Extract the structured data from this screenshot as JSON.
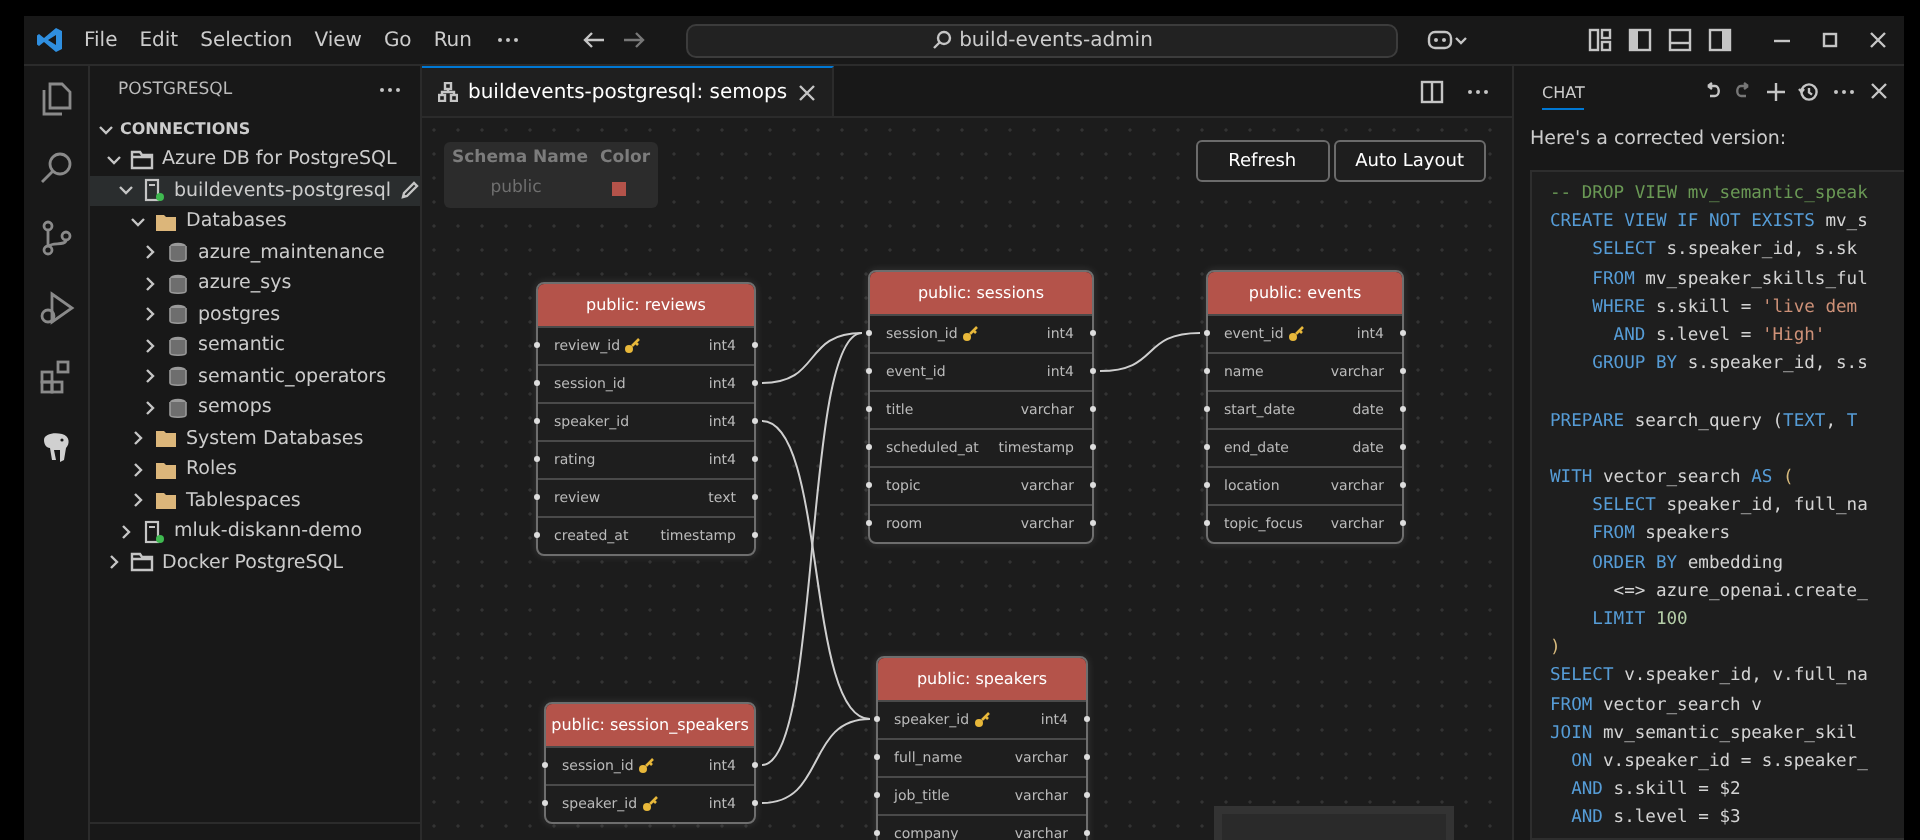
{
  "title_bar": {
    "menu": [
      "File",
      "Edit",
      "Selection",
      "View",
      "Go",
      "Run"
    ],
    "command_center": "build-events-admin"
  },
  "sidebar": {
    "title": "POSTGRESQL",
    "section": {
      "label": "CONNECTIONS",
      "expanded": true
    },
    "tree": [
      {
        "label": "Azure DB for PostgreSQL",
        "kind": "group",
        "expanded": true,
        "selected": false,
        "children": [
          {
            "label": "buildevents-postgresql",
            "kind": "server",
            "expanded": true,
            "selected": true,
            "children": [
              {
                "label": "Databases",
                "kind": "folder",
                "expanded": true,
                "selected": false,
                "children": [
                  {
                    "label": "azure_maintenance",
                    "kind": "database",
                    "expanded": false,
                    "selected": false
                  },
                  {
                    "label": "azure_sys",
                    "kind": "database",
                    "expanded": false,
                    "selected": false
                  },
                  {
                    "label": "postgres",
                    "kind": "database",
                    "expanded": false,
                    "selected": false
                  },
                  {
                    "label": "semantic",
                    "kind": "database",
                    "expanded": false,
                    "selected": false
                  },
                  {
                    "label": "semantic_operators",
                    "kind": "database",
                    "expanded": false,
                    "selected": false
                  },
                  {
                    "label": "semops",
                    "kind": "database",
                    "expanded": false,
                    "selected": false
                  }
                ]
              },
              {
                "label": "System Databases",
                "kind": "folder",
                "expanded": false,
                "selected": false
              },
              {
                "label": "Roles",
                "kind": "folder",
                "expanded": false,
                "selected": false
              },
              {
                "label": "Tablespaces",
                "kind": "folder",
                "expanded": false,
                "selected": false
              }
            ]
          },
          {
            "label": "mluk-diskann-demo",
            "kind": "server",
            "expanded": false,
            "selected": false
          }
        ]
      },
      {
        "label": "Docker PostgreSQL",
        "kind": "group",
        "expanded": false,
        "selected": false
      }
    ]
  },
  "editor": {
    "tabs": [
      {
        "label": "buildevents-postgresql: semops",
        "selected": true
      }
    ],
    "buttons": [
      "Refresh",
      "Auto Layout"
    ],
    "legend": {
      "columns": [
        "Schema Name",
        "Color"
      ],
      "rows": [
        {
          "schema": "public",
          "color": "#b4534a"
        }
      ]
    },
    "tables": [
      {
        "title": "public: reviews",
        "columns": [
          {
            "name": "review_id",
            "type": "int4",
            "key": true
          },
          {
            "name": "session_id",
            "type": "int4",
            "key": false
          },
          {
            "name": "speaker_id",
            "type": "int4",
            "key": false
          },
          {
            "name": "rating",
            "type": "int4",
            "key": false
          },
          {
            "name": "review",
            "type": "text",
            "key": false
          },
          {
            "name": "created_at",
            "type": "timestamp",
            "key": false
          }
        ]
      },
      {
        "title": "public: sessions",
        "columns": [
          {
            "name": "session_id",
            "type": "int4",
            "key": true
          },
          {
            "name": "event_id",
            "type": "int4",
            "key": false
          },
          {
            "name": "title",
            "type": "varchar",
            "key": false
          },
          {
            "name": "scheduled_at",
            "type": "timestamp",
            "key": false
          },
          {
            "name": "topic",
            "type": "varchar",
            "key": false
          },
          {
            "name": "room",
            "type": "varchar",
            "key": false
          }
        ]
      },
      {
        "title": "public: events",
        "columns": [
          {
            "name": "event_id",
            "type": "int4",
            "key": true
          },
          {
            "name": "name",
            "type": "varchar",
            "key": false
          },
          {
            "name": "start_date",
            "type": "date",
            "key": false
          },
          {
            "name": "end_date",
            "type": "date",
            "key": false
          },
          {
            "name": "location",
            "type": "varchar",
            "key": false
          },
          {
            "name": "topic_focus",
            "type": "varchar",
            "key": false
          }
        ]
      },
      {
        "title": "public: session_speakers",
        "columns": [
          {
            "name": "session_id",
            "type": "int4",
            "key": true
          },
          {
            "name": "speaker_id",
            "type": "int4",
            "key": true
          }
        ]
      },
      {
        "title": "public: speakers",
        "columns": [
          {
            "name": "speaker_id",
            "type": "int4",
            "key": true
          },
          {
            "name": "full_name",
            "type": "varchar",
            "key": false
          },
          {
            "name": "job_title",
            "type": "varchar",
            "key": false
          },
          {
            "name": "company",
            "type": "varchar",
            "key": false
          }
        ]
      }
    ]
  },
  "chat": {
    "tabs": [
      {
        "label": "CHAT",
        "selected": true
      }
    ],
    "message": "Here's a corrected version:",
    "code": [
      {
        "tokens": [
          {
            "text": "-- DROP VIEW mv_semantic_speak",
            "kind": "comment"
          }
        ]
      },
      {
        "tokens": [
          {
            "text": "CREATE VIEW IF NOT EXISTS",
            "kind": "keyword"
          },
          {
            "text": " mv_s",
            "kind": "plain"
          }
        ]
      },
      {
        "tokens": [
          {
            "text": "    SELECT",
            "kind": "keyword"
          },
          {
            "text": " s.speaker_id, s.sk",
            "kind": "plain"
          }
        ]
      },
      {
        "tokens": [
          {
            "text": "    FROM",
            "kind": "keyword"
          },
          {
            "text": " mv_speaker_skills_ful",
            "kind": "plain"
          }
        ]
      },
      {
        "tokens": [
          {
            "text": "    WHERE",
            "kind": "keyword"
          },
          {
            "text": " s.skill = ",
            "kind": "plain"
          },
          {
            "text": "'live dem",
            "kind": "string"
          }
        ]
      },
      {
        "tokens": [
          {
            "text": "      AND",
            "kind": "keyword"
          },
          {
            "text": " s.level = ",
            "kind": "plain"
          },
          {
            "text": "'High'",
            "kind": "string"
          }
        ]
      },
      {
        "tokens": [
          {
            "text": "    GROUP BY",
            "kind": "keyword"
          },
          {
            "text": " s.speaker_id, s.s",
            "kind": "plain"
          }
        ]
      },
      {
        "gap_before": true,
        "tokens": [
          {
            "text": "PREPARE",
            "kind": "keyword"
          },
          {
            "text": " search_query (",
            "kind": "plain"
          },
          {
            "text": "TEXT",
            "kind": "keyword"
          },
          {
            "text": ", ",
            "kind": "plain"
          },
          {
            "text": "T",
            "kind": "keyword"
          }
        ]
      },
      {
        "gap_before": true,
        "tokens": [
          {
            "text": "WITH",
            "kind": "keyword"
          },
          {
            "text": " vector_search ",
            "kind": "plain"
          },
          {
            "text": "AS",
            "kind": "keyword"
          },
          {
            "text": " (",
            "kind": "bracket"
          }
        ]
      },
      {
        "tokens": [
          {
            "text": "    SELECT",
            "kind": "keyword"
          },
          {
            "text": " speaker_id, full_na",
            "kind": "plain"
          }
        ]
      },
      {
        "tokens": [
          {
            "text": "    FROM",
            "kind": "keyword"
          },
          {
            "text": " speakers",
            "kind": "plain"
          }
        ]
      },
      {
        "tokens": [
          {
            "text": "    ORDER BY",
            "kind": "keyword"
          },
          {
            "text": " embedding",
            "kind": "plain"
          }
        ]
      },
      {
        "tokens": [
          {
            "text": "      <=> azure_openai.create_",
            "kind": "plain"
          }
        ]
      },
      {
        "tokens": [
          {
            "text": "    LIMIT",
            "kind": "keyword"
          },
          {
            "text": " 100",
            "kind": "number"
          }
        ]
      },
      {
        "tokens": [
          {
            "text": ")",
            "kind": "bracket"
          }
        ]
      },
      {
        "tokens": [
          {
            "text": "SELECT",
            "kind": "keyword"
          },
          {
            "text": " v.speaker_id, v.full_na",
            "kind": "plain"
          }
        ]
      },
      {
        "tokens": [
          {
            "text": "FROM",
            "kind": "keyword"
          },
          {
            "text": " vector_search v",
            "kind": "plain"
          }
        ]
      },
      {
        "tokens": [
          {
            "text": "JOIN",
            "kind": "keyword"
          },
          {
            "text": " mv_semantic_speaker_skil",
            "kind": "plain"
          }
        ]
      },
      {
        "tokens": [
          {
            "text": "  ON",
            "kind": "keyword"
          },
          {
            "text": " v.speaker_id = s.speaker_",
            "kind": "plain"
          }
        ]
      },
      {
        "tokens": [
          {
            "text": "  AND",
            "kind": "keyword"
          },
          {
            "text": " s.skill = $2",
            "kind": "plain"
          }
        ]
      },
      {
        "tokens": [
          {
            "text": "  AND",
            "kind": "keyword"
          },
          {
            "text": " s.level = $3",
            "kind": "plain"
          }
        ]
      }
    ]
  }
}
